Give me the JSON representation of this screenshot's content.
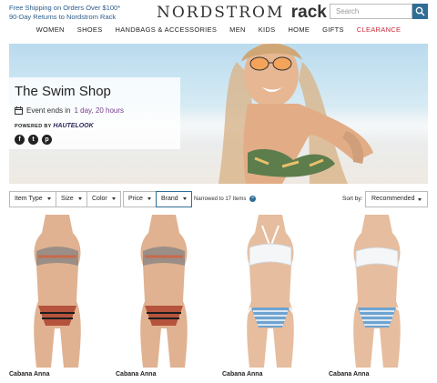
{
  "header": {
    "promo_line1": "Free Shipping on Orders Over $100*",
    "promo_line2": "90-Day Returns to Nordstrom Rack",
    "logo_text": "NORDSTROM",
    "logo_rack": "rack",
    "search_placeholder": "Search"
  },
  "nav": {
    "items": [
      "WOMEN",
      "SHOES",
      "HANDBAGS & ACCESSORIES",
      "MEN",
      "KIDS",
      "HOME",
      "GIFTS",
      "CLEARANCE"
    ],
    "clearance_color": "#c8283b"
  },
  "hero": {
    "title": "The Swim Shop",
    "event_prefix": "Event ends in",
    "event_time": "1 day, 20 hours",
    "powered_by": "POWERED BY",
    "powered_brand": "HAUTELOOK",
    "social_icons": [
      "facebook-icon",
      "twitter-icon",
      "pinterest-icon"
    ]
  },
  "filters": {
    "buttons": [
      "Item Type",
      "Size",
      "Color",
      "Price",
      "Brand"
    ],
    "active": "Brand",
    "narrowed_text": "Narrowed to 17 Items",
    "sort_label": "Sort by:",
    "sort_value": "Recommended"
  },
  "products": [
    {
      "brand": "Cabana Anna",
      "style": "tribal"
    },
    {
      "brand": "Cabana Anna",
      "style": "tribal"
    },
    {
      "brand": "Cabana Anna",
      "style": "stripe"
    },
    {
      "brand": "Cabana Anna",
      "style": "stripe"
    }
  ],
  "colors": {
    "accent": "#2f6d94",
    "link": "#2a5c8a",
    "event_highlight": "#7a3d8c"
  }
}
